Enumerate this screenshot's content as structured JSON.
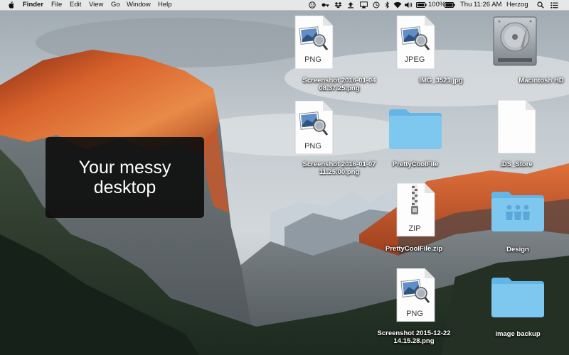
{
  "menubar": {
    "apple_icon": "apple-logo-icon",
    "app_name": "Finder",
    "menus": [
      "File",
      "Edit",
      "View",
      "Go",
      "Window",
      "Help"
    ],
    "status_icons": [
      "face-icon",
      "key-icon",
      "dropbox-icon",
      "upload-icon",
      "airplay-icon",
      "time-machine-icon",
      "bluetooth-icon",
      "wifi-icon",
      "volume-icon"
    ],
    "battery_percent": "100%",
    "clock": "Thu 11:26 AM",
    "user": "Herzog",
    "search_icon": "spotlight-search-icon",
    "list_icon": "notification-center-icon"
  },
  "overlay": {
    "text": "Your messy\ndesktop"
  },
  "desktop": {
    "screenshot_2016_01_04": {
      "badge": "PNG",
      "name": "Screenshot 2016-01-04\n08.37.25.png",
      "icon": "png-file-icon"
    },
    "img_3521": {
      "badge": "JPEG",
      "name": "IMG_3521.jpg",
      "icon": "jpeg-file-icon"
    },
    "macintosh_hd": {
      "name": "Macintosh HD",
      "icon": "hard-drive-icon"
    },
    "screenshot_2016_01_07": {
      "badge": "PNG",
      "name": "Screenshot 2016-01-07\n11.25.00.png",
      "icon": "png-file-icon"
    },
    "prettycoolfile_folder": {
      "name": "PrettyCoolFile",
      "icon": "folder-icon"
    },
    "ds_store": {
      "name": ".DS_Store",
      "icon": "blank-file-icon"
    },
    "prettycoolfile_zip": {
      "badge": "ZIP",
      "name": "PrettyCoolFile.zip",
      "icon": "zip-file-icon"
    },
    "design": {
      "name": "Design",
      "icon": "shared-folder-icon"
    },
    "screenshot_2015_12_22": {
      "badge": "PNG",
      "name": "Screenshot 2015-12-22\n14.15.28.png",
      "icon": "png-file-icon"
    },
    "image_backup": {
      "name": "image backup",
      "icon": "folder-icon"
    }
  },
  "colors": {
    "folder": "#7ec8f0",
    "folder_tab": "#62b6e6",
    "overlay_bg": "#0c0c0c",
    "sky": "#b8c2c8",
    "rock_lit": "#d8622c"
  }
}
